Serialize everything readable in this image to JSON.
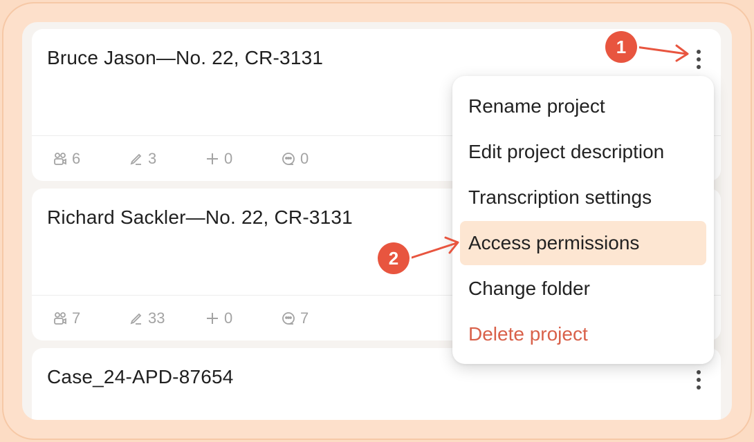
{
  "cards": [
    {
      "title": "Bruce Jason—No. 22, CR-3131",
      "stats": {
        "members": "6",
        "edits": "3",
        "added": "0",
        "transcripts": "0"
      }
    },
    {
      "title": "Richard Sackler—No. 22, CR-3131",
      "stats": {
        "members": "7",
        "edits": "33",
        "added": "0",
        "transcripts": "7"
      }
    },
    {
      "title": "Case_24-APD-87654"
    }
  ],
  "menu": {
    "items": [
      {
        "label": "Rename project"
      },
      {
        "label": "Edit project description"
      },
      {
        "label": "Transcription settings"
      },
      {
        "label": "Access permissions",
        "highlighted": true
      },
      {
        "label": "Change folder"
      },
      {
        "label": "Delete project",
        "danger": true
      }
    ]
  },
  "annotations": {
    "step1": "1",
    "step2": "2"
  },
  "colors": {
    "accent": "#e8553f",
    "highlight": "#fde6d2",
    "danger": "#d9614a",
    "frame": "#fde0cb"
  }
}
